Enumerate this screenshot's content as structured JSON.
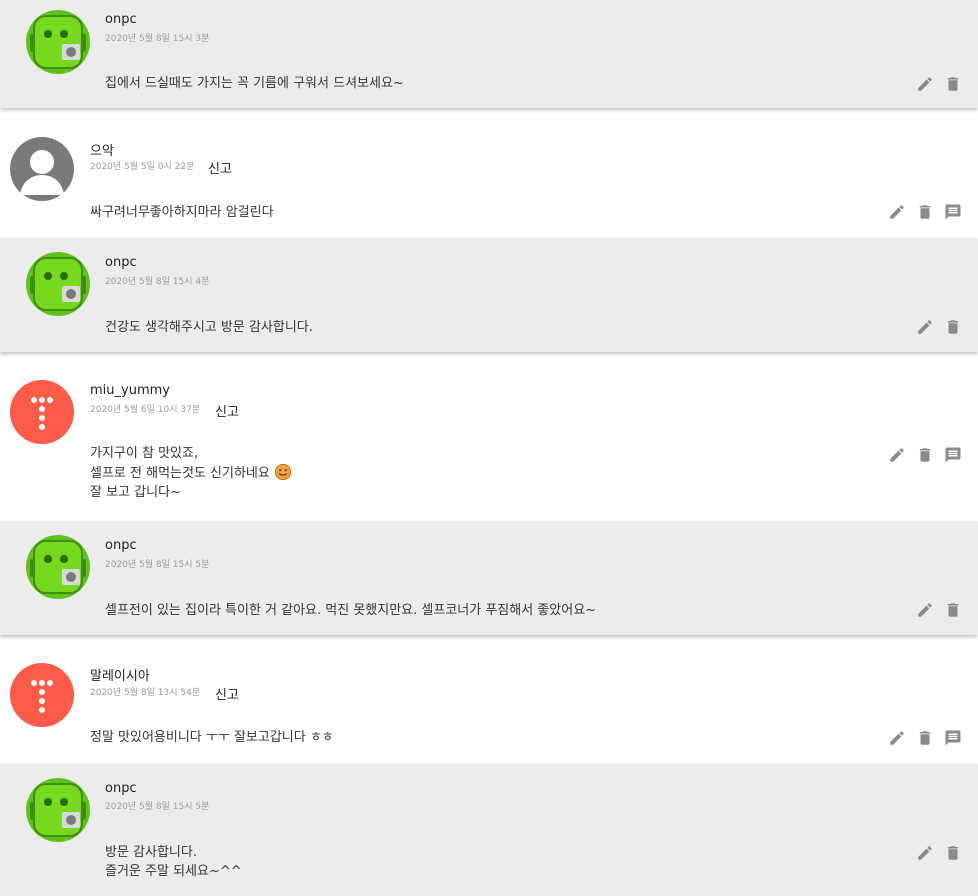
{
  "icons": [
    "pencil-icon",
    "trash-icon",
    "reply-icon",
    "smiley-icon"
  ],
  "colors": {
    "reply_bg": "#ececec",
    "icon": "#8a8a8a",
    "avatar_coral": "#ff5b4a",
    "avatar_gray": "#7a7a7a",
    "avatar_green": "#5fc41a"
  },
  "comments": [
    {
      "type": "reply",
      "name": "onpc",
      "date": "2020년 5월 8일 15시 3분",
      "lines": [
        "집에서 드실때도 가지는 꼭 기름에 구워서 드셔보세요~"
      ]
    },
    {
      "type": "comment",
      "name": "으악",
      "date": "2020년 5월 5일 0시 22분",
      "report": "신고",
      "lines": [
        "싸구려너무좋아하지마라 암걸린다"
      ]
    },
    {
      "type": "reply",
      "name": "onpc",
      "date": "2020년 5월 8일 15시 4분",
      "lines": [
        "건강도 생각해주시고 방문 감사합니다."
      ]
    },
    {
      "type": "comment",
      "name": "miu_yummy",
      "date": "2020년 5월 6일 10시 37분",
      "report": "신고",
      "lines": [
        "가지구이 참 맛있죠,",
        "셀프로 전 해먹는것도 신기하네요",
        "잘 보고 갑니다~"
      ]
    },
    {
      "type": "reply",
      "name": "onpc",
      "date": "2020년 5월 8일 15시 5분",
      "lines": [
        "셀프전이 있는 집이라 특이한 거 같아요. 먹진 못했지만요. 셀프코너가 푸짐해서 좋았어요~"
      ]
    },
    {
      "type": "comment",
      "name": "말레이시아",
      "date": "2020년 5월 8일 13시 54분",
      "report": "신고",
      "lines": [
        "정말 맛있어용비니다 ㅜㅜ 잘보고갑니다 ㅎㅎ"
      ]
    },
    {
      "type": "reply",
      "name": "onpc",
      "date": "2020년 5월 8일 15시 5분",
      "lines": [
        "방문 감사합니다.",
        "즐거운 주말 되세요~^^"
      ]
    }
  ]
}
